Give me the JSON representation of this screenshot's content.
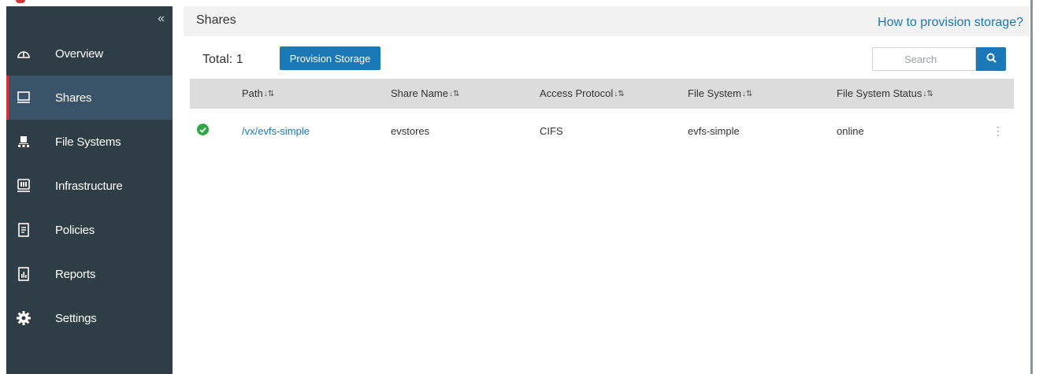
{
  "sidebar": {
    "collapse_glyph": "«",
    "items": [
      {
        "label": "Overview",
        "icon": "dashboard-gauge-icon"
      },
      {
        "label": "Shares",
        "icon": "monitor-icon",
        "active": true
      },
      {
        "label": "File Systems",
        "icon": "network-hierarchy-icon"
      },
      {
        "label": "Infrastructure",
        "icon": "server-rack-icon"
      },
      {
        "label": "Policies",
        "icon": "document-list-icon"
      },
      {
        "label": "Reports",
        "icon": "bar-report-icon"
      },
      {
        "label": "Settings",
        "icon": "gear-icon"
      }
    ],
    "active_color": "#3b5368",
    "active_marker_color": "#d0383a",
    "background": "#2f3e46"
  },
  "header": {
    "title": "Shares",
    "help_link": "How to provision storage?"
  },
  "toolbar": {
    "total_label": "Total: 1",
    "provision_button": "Provision Storage",
    "search_placeholder": "Search"
  },
  "table": {
    "columns": [
      "Path",
      "Share Name",
      "Access Protocol",
      "File System",
      "File System Status"
    ],
    "sort_glyph": "↓A↓",
    "rows": [
      {
        "status": "ok",
        "path": "/vx/evfs-simple",
        "share_name": "evstores",
        "access_protocol": "CIFS",
        "file_system": "evfs-simple",
        "file_system_status": "online"
      }
    ]
  },
  "colors": {
    "accent": "#1a78b7",
    "status_ok": "#2fa745",
    "header_bg": "#f2f2f2",
    "table_header_bg": "#dcdcdc"
  }
}
